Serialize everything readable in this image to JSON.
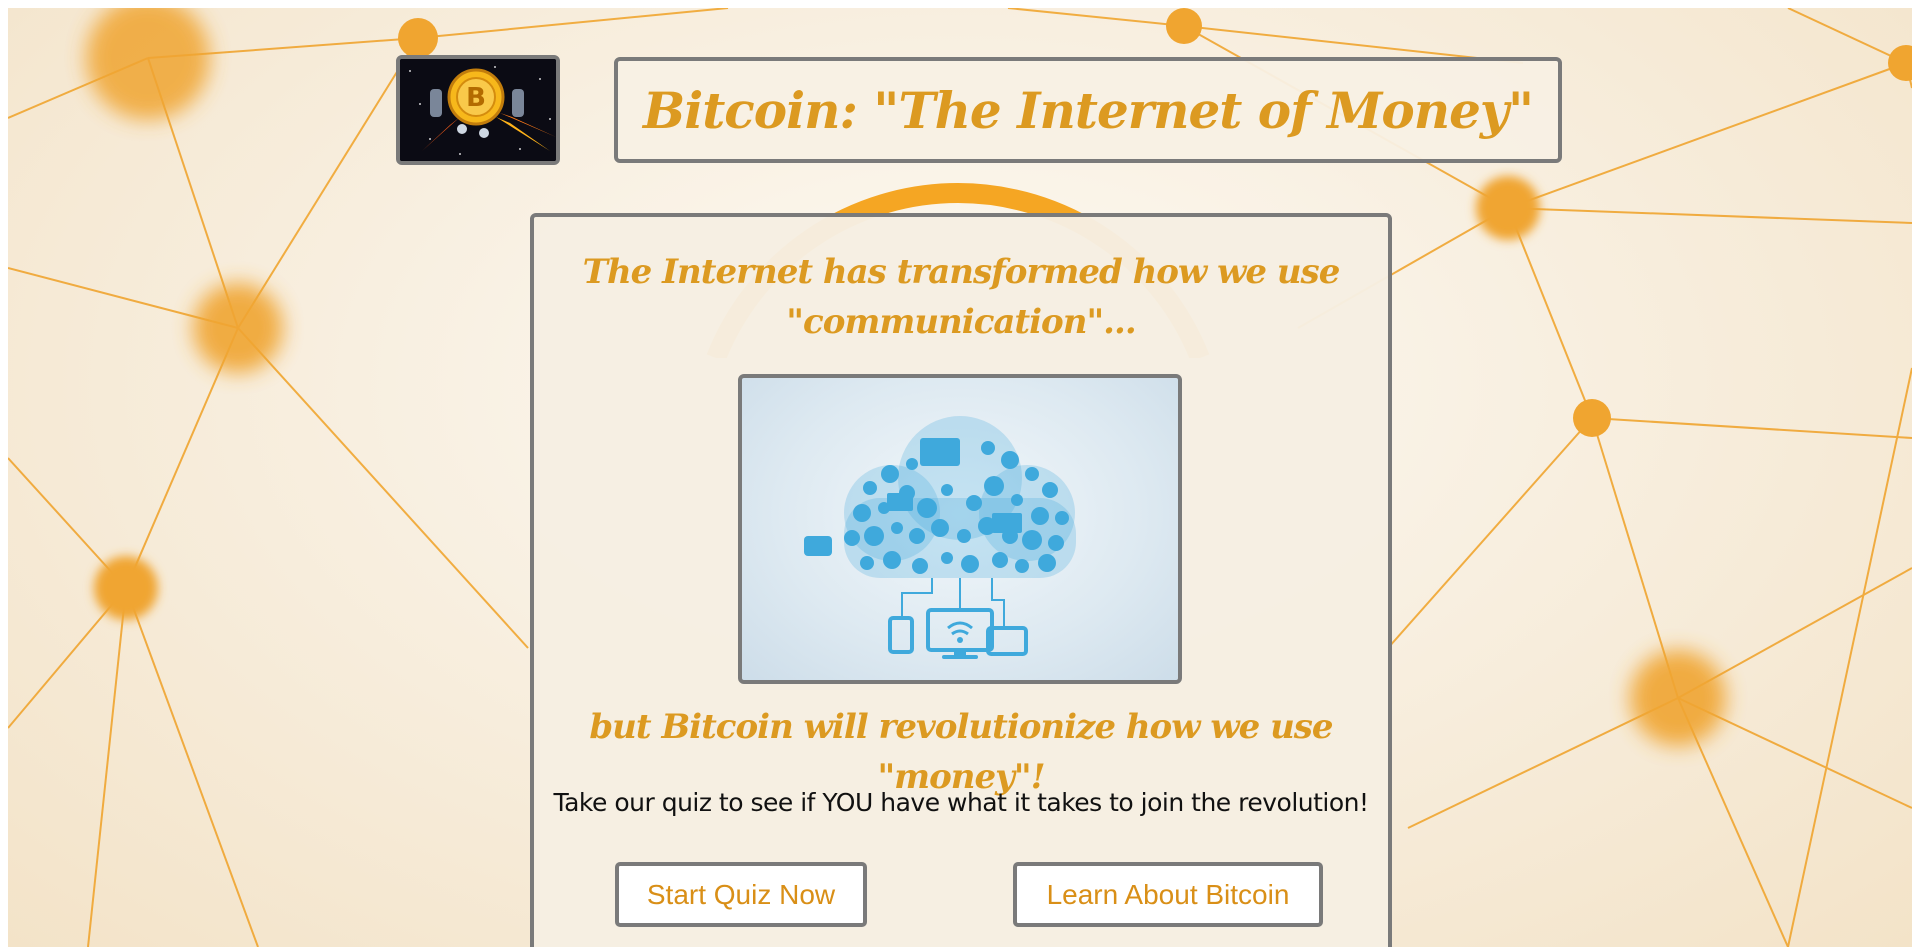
{
  "header": {
    "title": "Bitcoin: \"The Internet of Money\"",
    "logo_icon": "bitcoin-rocket-logo"
  },
  "main": {
    "headline_1": "The Internet has transformed how we use \"communication\"...",
    "image_icon": "cloud-devices-network-illustration",
    "headline_2": "but Bitcoin will revolutionize how we use \"money\"!",
    "quiz_text": "Take our quiz to see if YOU have what it takes to join the revolution!",
    "buttons": {
      "start_quiz": "Start Quiz Now",
      "learn": "Learn About Bitcoin"
    }
  },
  "colors": {
    "accent": "#dc9a21",
    "network": "#f0a530",
    "border": "#7a7a7a",
    "cloud": "#3fa9dc"
  }
}
